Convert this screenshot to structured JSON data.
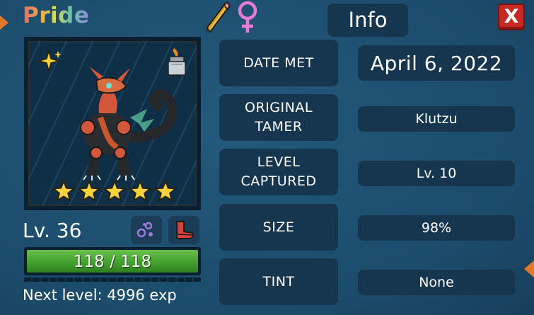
{
  "pet": {
    "name": "Pride",
    "gender_icon": "female-icon",
    "level_text": "Lv. 36",
    "hp_text": "118 / 118",
    "hp": {
      "current": 118,
      "max": 118
    },
    "next_level_text": "Next level: 4996 exp",
    "stars": 5,
    "badges": [
      "sparkle-icon",
      "lighter-icon"
    ]
  },
  "header": {
    "title": "Info",
    "close_label": "X"
  },
  "info_rows": [
    {
      "label_lines": [
        "DATE MET"
      ],
      "value": "April 6, 2022"
    },
    {
      "label_lines": [
        "ORIGINAL",
        "TAMER"
      ],
      "value": "Klutzu"
    },
    {
      "label_lines": [
        "LEVEL",
        "CAPTURED"
      ],
      "value": "Lv. 10"
    },
    {
      "label_lines": [
        "SIZE"
      ],
      "value": "98%"
    },
    {
      "label_lines": [
        "TINT"
      ],
      "value": "None"
    }
  ],
  "colors": {
    "background": "#1d4e6f",
    "panel": "#163650",
    "hp_green": "#43a02f",
    "star_yellow": "#f6d33c",
    "close_red": "#c62a22"
  },
  "icons": [
    "pencil-icon",
    "female-icon",
    "sparkle-icon",
    "lighter-icon",
    "bubbles-skill-icon",
    "boot-skill-icon",
    "close-icon"
  ]
}
